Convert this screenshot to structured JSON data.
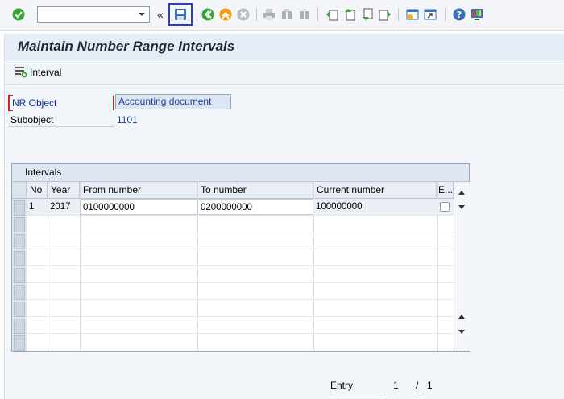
{
  "toolbar": {
    "command_field_value": "",
    "icons": [
      "check-icon",
      "back-double-icon",
      "save-icon",
      "back-icon",
      "exit-icon",
      "cancel-icon",
      "print-icon",
      "find-icon",
      "find-next-icon",
      "first-page-icon",
      "previous-page-icon",
      "next-page-icon",
      "last-page-icon",
      "create-session-icon",
      "shortcut-icon",
      "help-icon",
      "customize-icon"
    ],
    "double_chevron": "«"
  },
  "header": {
    "title": "Maintain Number Range Intervals"
  },
  "appbar": {
    "interval_button_label": "Interval"
  },
  "form": {
    "nr_object_label": "NR Object",
    "nr_object_value": "Accounting document",
    "subobject_label": "Subobject",
    "subobject_value": "1101"
  },
  "intervals": {
    "title": "Intervals",
    "columns": [
      "No",
      "Year",
      "From number",
      "To number",
      "Current number",
      "E..."
    ],
    "rows": [
      {
        "no": "1",
        "year": "2017",
        "from": "0100000000",
        "to": "0200000000",
        "current": "100000000",
        "ext": false
      }
    ]
  },
  "footer": {
    "entry_label": "Entry",
    "entry_current": "1",
    "entry_slash": "/",
    "entry_total": "1"
  },
  "colors": {
    "accent_blue": "#1c3fa0",
    "highlight_border": "#2c3fae",
    "required_marker": "#d02222"
  }
}
